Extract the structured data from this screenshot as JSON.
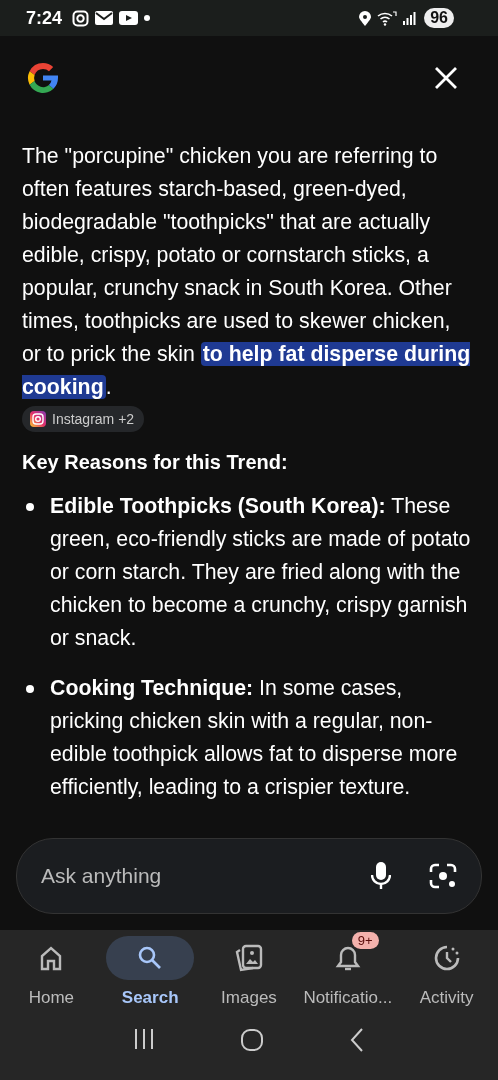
{
  "status_bar": {
    "time": "7:24",
    "battery": "96"
  },
  "answer": {
    "before": "The \"porcupine\" chicken you are referring to often features starch-based, green-dyed, biodegradable \"toothpicks\" that are actually edible, crispy, potato or cornstarch sticks, a popular, crunchy snack in South Korea. Other times, toothpicks are used to skewer chicken, or to prick the skin ",
    "highlight": "to help fat disperse during cooking",
    "after": ".",
    "source": "Instagram +2"
  },
  "heading": "Key Reasons for this Trend:",
  "bullets": [
    "**Edible Toothpicks (South Korea):** These green, eco-friendly sticks are made of potato or corn starch. They are fried along with the chicken to become a crunchy, crispy garnish or snack.",
    "**Cooking Technique:** In some cases, pricking chicken skin with a regular, non-edible toothpick allows fat to disperse more efficiently, leading to a crispier texture."
  ],
  "search": {
    "placeholder": "Ask anything"
  },
  "nav": [
    {
      "label": "Home",
      "selected": false
    },
    {
      "label": "Search",
      "selected": true
    },
    {
      "label": "Images",
      "selected": false
    },
    {
      "label": "Notificatio...",
      "selected": false,
      "badge": "9+"
    },
    {
      "label": "Activity",
      "selected": false
    }
  ]
}
